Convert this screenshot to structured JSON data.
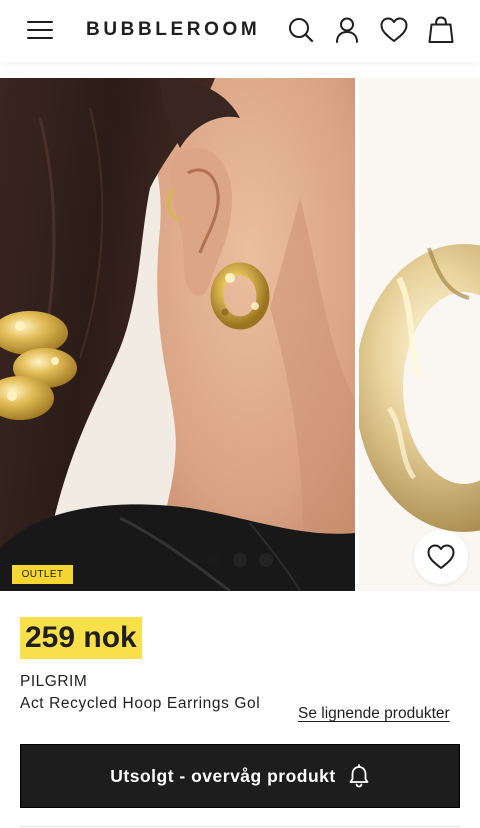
{
  "header": {
    "logo": "BUBBLEROOM",
    "icons": [
      "menu-icon",
      "search-icon",
      "account-icon",
      "heart-icon",
      "bag-icon"
    ]
  },
  "gallery": {
    "badge": "OUTLET",
    "total_images": 3,
    "active_index": 1
  },
  "product": {
    "price": "259 nok",
    "brand": "PILGRIM",
    "name": "Act Recycled Hoop Earrings Gol",
    "similar_link": "Se lignende produkter",
    "cta_label": "Utsolgt - overvåg produkt"
  },
  "colors": {
    "price_highlight": "#f9e04b",
    "badge": "#f5d633",
    "cta_background": "#1d1d1d",
    "text": "#1f1f1f"
  }
}
